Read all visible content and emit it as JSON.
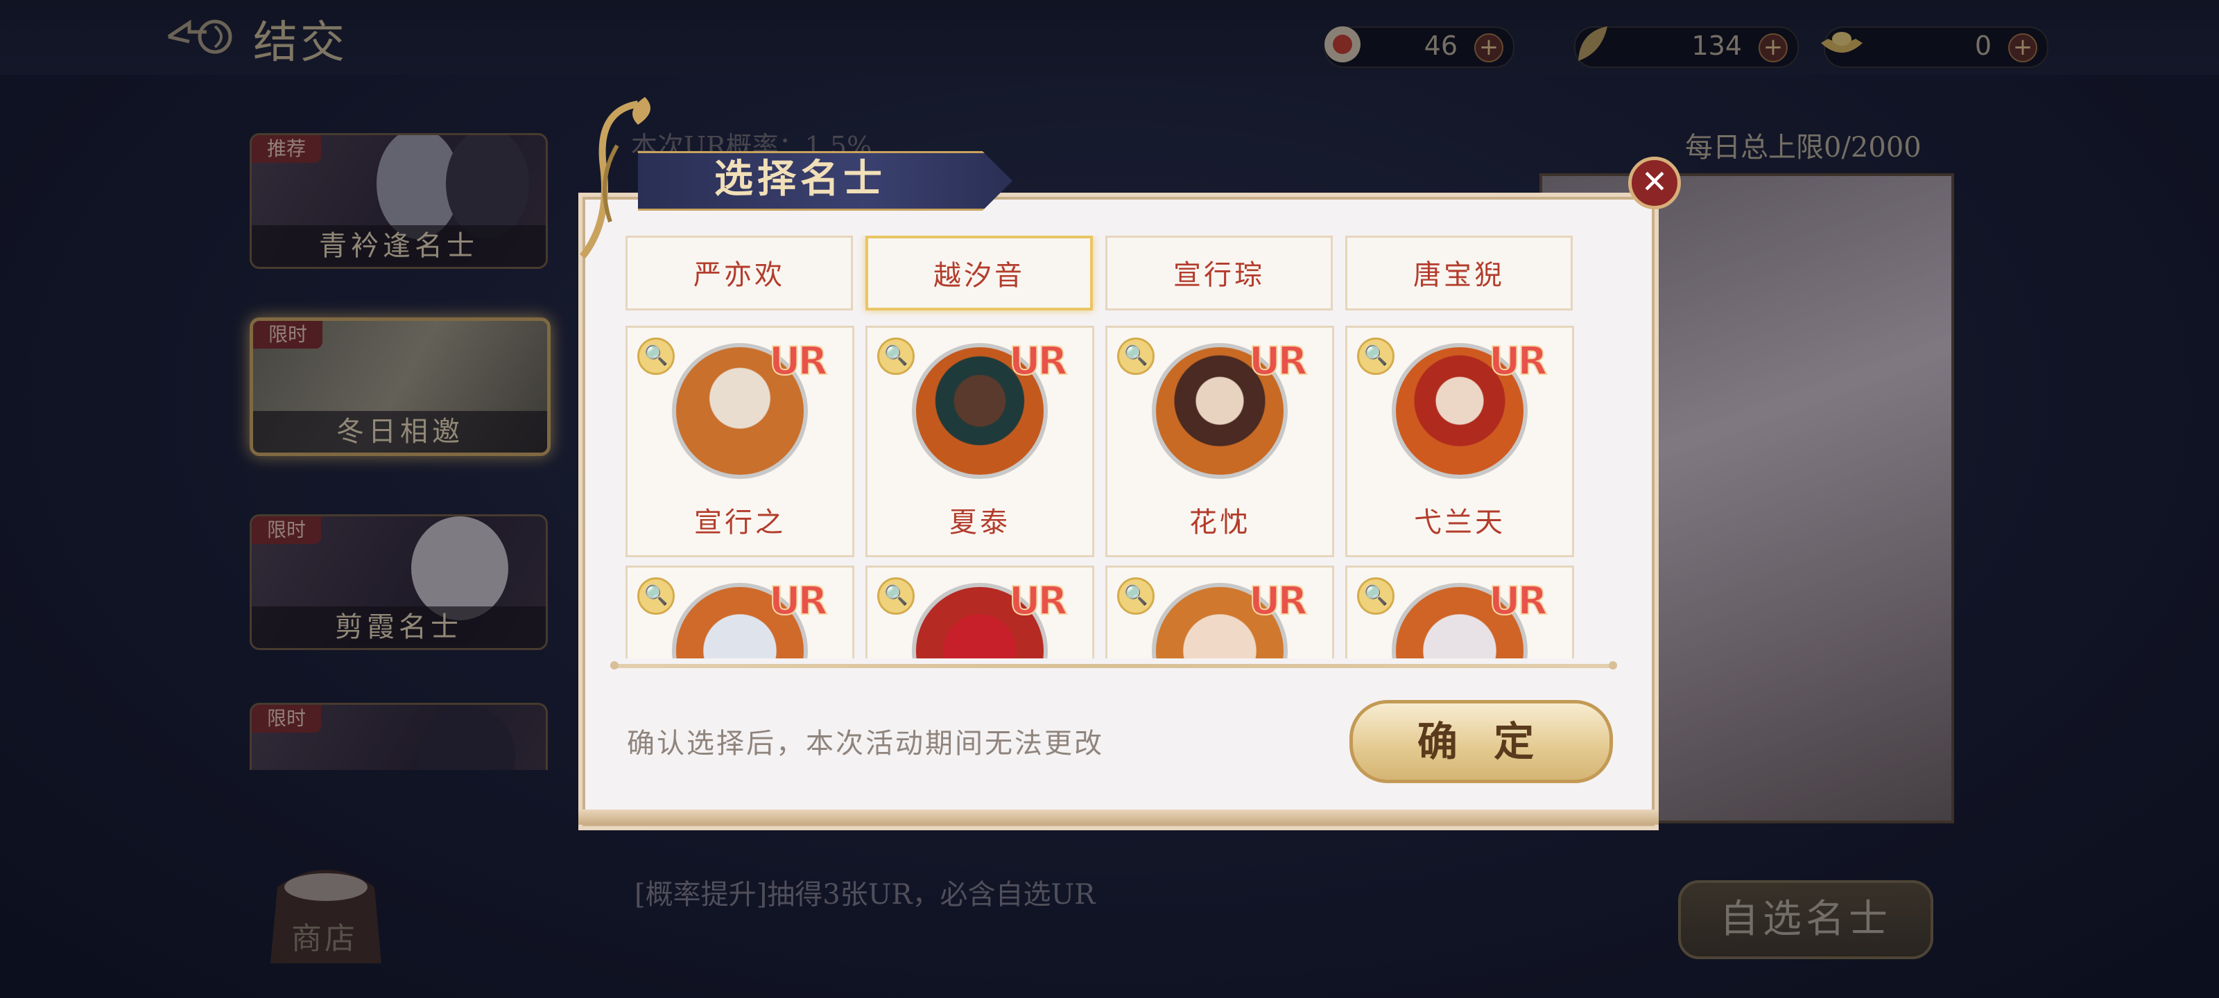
{
  "header": {
    "title": "结交",
    "resources": [
      {
        "name": "summon-token",
        "value": "46"
      },
      {
        "name": "leaf-token",
        "value": "134"
      },
      {
        "name": "ingot",
        "value": "0"
      }
    ]
  },
  "background": {
    "prob_text": "本次UR概率：1.5%",
    "daily_limit": "每日总上限0/2000",
    "bottom_info": "[概率提升]抽得3张UR，必含自选UR",
    "select_button": "自选名士",
    "shop_label": "商店",
    "banners": [
      {
        "tag": "推荐",
        "label": "青衿逢名士"
      },
      {
        "tag": "限时",
        "label": "冬日相邀"
      },
      {
        "tag": "限时",
        "label": "剪霞名士"
      },
      {
        "tag": "限时",
        "label": ""
      }
    ]
  },
  "dialog": {
    "title": "选择名士",
    "close_symbol": "✕",
    "name_tabs": [
      "严亦欢",
      "越汐音",
      "宣行琮",
      "唐宝猊"
    ],
    "selected_tab": "越汐音",
    "cards_row1": [
      {
        "name": "宣行之",
        "rarity": "UR",
        "color": "#c9702c"
      },
      {
        "name": "夏泰",
        "rarity": "UR",
        "color": "#c4591e"
      },
      {
        "name": "花忱",
        "rarity": "UR",
        "color": "#c86a24"
      },
      {
        "name": "弋兰天",
        "rarity": "UR",
        "color": "#cf5a20"
      }
    ],
    "cards_row2": [
      {
        "name": "",
        "rarity": "UR",
        "color": "#cf6a2a"
      },
      {
        "name": "",
        "rarity": "UR",
        "color": "#b52a22"
      },
      {
        "name": "",
        "rarity": "UR",
        "color": "#d0782e"
      },
      {
        "name": "",
        "rarity": "UR",
        "color": "#cf6426"
      }
    ],
    "zoom_symbol": "🔍",
    "hint": "确认选择后，本次活动期间无法更改",
    "confirm_label": "确 定"
  }
}
